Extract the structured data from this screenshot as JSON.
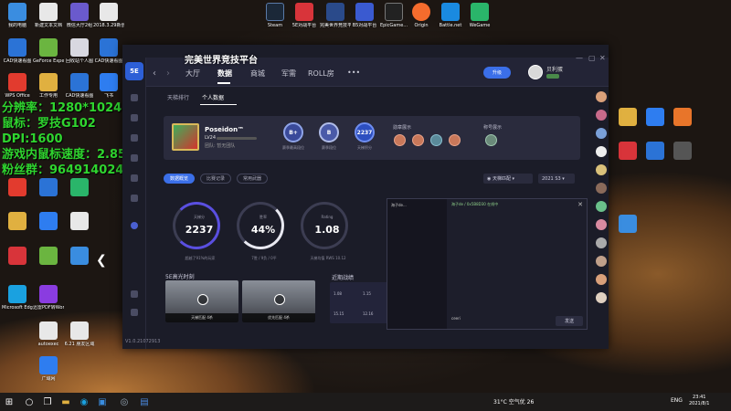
{
  "desktop_icons": [
    {
      "label": "我的电脑",
      "color": "#3a8de0"
    },
    {
      "label": "新建文本文档",
      "color": "#e8e8e8"
    },
    {
      "label": "微信大厅2组",
      "color": "#6a5acd"
    },
    {
      "label": "2018.3.29新创周报",
      "color": "#e8e8e8"
    },
    {
      "label": "CAD快速看图",
      "color": "#2b73d6"
    },
    {
      "label": "GeForce Experience",
      "color": "#6bb540"
    },
    {
      "label": "回收站个人图",
      "color": "#d8d8e0"
    },
    {
      "label": "CAD快速看图",
      "color": "#2b73d6"
    },
    {
      "label": "WPS Office",
      "color": "#e23b2e"
    },
    {
      "label": "工作专用",
      "color": "#e0b040"
    },
    {
      "label": "CAD快速看图",
      "color": "#2b73d6"
    },
    {
      "label": "飞书",
      "color": "#2e7df0"
    },
    {
      "label": "Microsoft Edge",
      "color": "#1aa1e0"
    },
    {
      "label": "迅雷PDF转Word",
      "color": "#8a3ce0"
    },
    {
      "label": "autoexec",
      "color": "#e8e8e8"
    },
    {
      "label": "6.21 朋友区域",
      "color": "#e8e8e8"
    },
    {
      "label": "广域网",
      "color": "#2e7df0"
    }
  ],
  "top_icons": [
    {
      "label": "Steam",
      "color": "#1b2838"
    },
    {
      "label": "5E对战平台",
      "color": "#d8343a"
    },
    {
      "label": "完美世界竞技平台",
      "color": "#2a4a8a"
    },
    {
      "label": "B5对战平台",
      "color": "#3a5ad0"
    },
    {
      "label": "EpicGame...",
      "color": "#222"
    },
    {
      "label": "Origin",
      "color": "#f56c2d"
    },
    {
      "label": "Battle.net",
      "color": "#1a8ae0"
    },
    {
      "label": "WeGame",
      "color": "#2ab56a"
    }
  ],
  "overlay": {
    "line1": "分辨率：1280*1024",
    "line2": "鼠标：罗技G102",
    "line3": "DPI:1600",
    "line4": "游戏内鼠标速度：2.85",
    "line5": "粉丝群：964914024"
  },
  "app": {
    "title_overlay": "完美世界竞技平台",
    "logo": "5E",
    "nav_tabs": [
      "大厅",
      "数据",
      "商城",
      "军需",
      "ROLL房",
      "•••"
    ],
    "upgrade_label": "升级",
    "username": "贝利蛋",
    "sub_tabs": [
      "天梯排行",
      "个人数据"
    ],
    "profile": {
      "name": "Poseidon™",
      "level": "LV24",
      "sub": "团队: 暂无团队",
      "rank_b_plus_1": "B+",
      "rank_b_plus_1_label": "赛季最高段位",
      "rank_b_plus_2": "B",
      "rank_b_plus_2_label": "赛季段位",
      "rank_score": "2237",
      "rank_score_label": "天梯积分",
      "medal_title": "勋章展示",
      "title_title": "称号展示"
    },
    "filters": {
      "tabs": [
        "数据概览",
        "比赛记录",
        "常用武器"
      ],
      "mode": "天梯匹配",
      "season": "2021 S3"
    },
    "stats": [
      {
        "label": "天梯分",
        "value": "2237",
        "foot": "超越了91%的玩家"
      },
      {
        "label": "胜率",
        "value": "44%",
        "foot": "7胜 / 9负 / 0平"
      },
      {
        "label": "Rating",
        "value": "1.08",
        "foot": "天梯均值 RWS 10.12"
      }
    ],
    "highlights": {
      "title": "5E高光时刻",
      "clips": [
        {
          "caption": "天梯匹配 4杀"
        },
        {
          "caption": "优先匹配 4杀"
        }
      ]
    },
    "recent": {
      "title": "近期战绩",
      "values": [
        "1.08",
        "1.15",
        "15.15",
        "12.16"
      ]
    },
    "version": "V1.0.21072913"
  },
  "chat": {
    "user": "海子de...",
    "header": "海子de / 0x5B8D30 在线中",
    "input": "ceeri",
    "send": "发送"
  },
  "taskbar": {
    "weather": "31°C 空气优 26",
    "lang": "ENG",
    "time": "23:41",
    "date": "2021/8/1"
  }
}
